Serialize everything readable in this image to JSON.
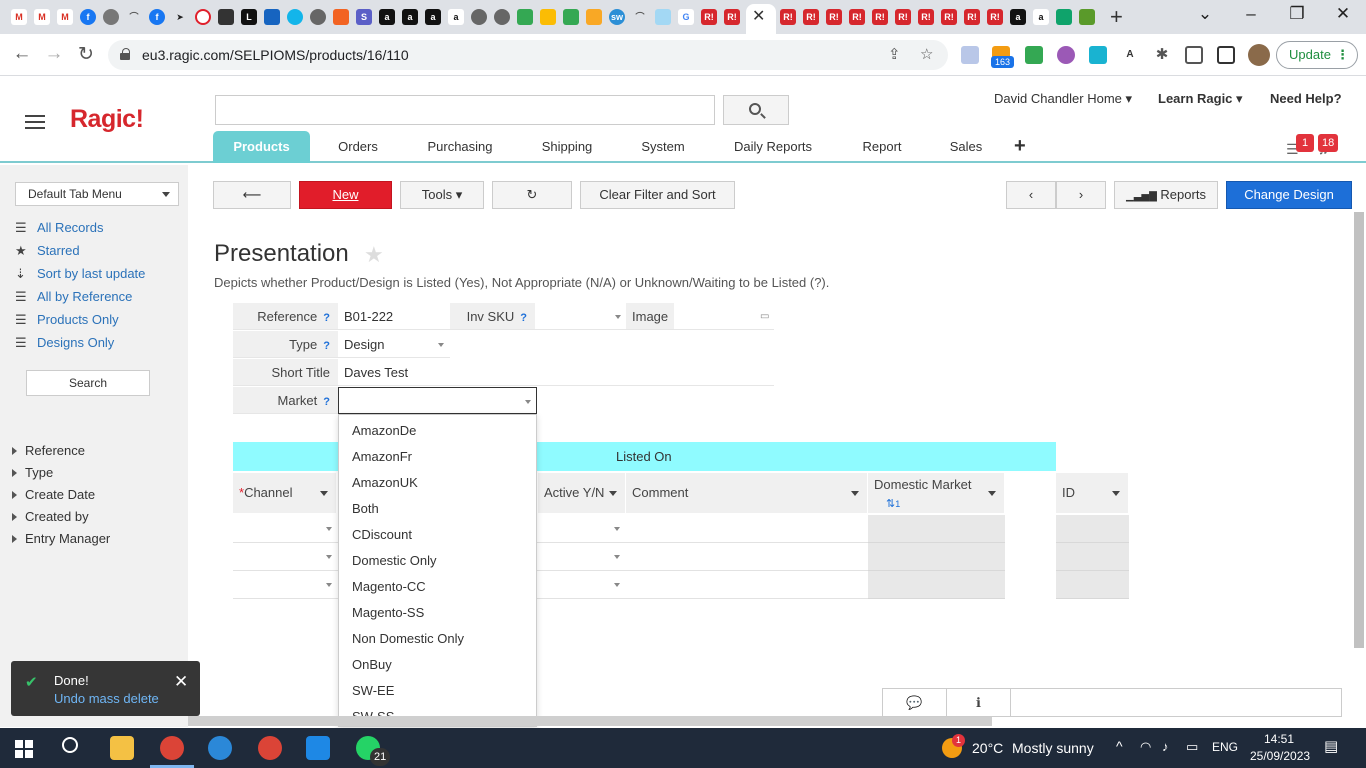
{
  "browser": {
    "url": "eu3.ragic.com/SELPIOMS/products/16/110",
    "update_label": "Update",
    "ext_badge": "163"
  },
  "header": {
    "logo": "Ragic!",
    "home_link": "David Chandler Home",
    "learn_link": "Learn Ragic",
    "help_link": "Need Help?",
    "tabs": [
      "Products",
      "Orders",
      "Purchasing",
      "Shipping",
      "System",
      "Daily Reports",
      "Report",
      "Sales"
    ],
    "plus": "+",
    "badge_tasks": "1",
    "badge_notifications": "18"
  },
  "sidebar": {
    "tab_menu": "Default Tab Menu",
    "views": [
      "All Records",
      "Starred",
      "Sort by last update",
      "All by Reference",
      "Products Only",
      "Designs Only"
    ],
    "search_label": "Search",
    "fields": [
      "Reference",
      "Type",
      "Create Date",
      "Created by",
      "Entry Manager"
    ]
  },
  "actions": {
    "new_label": "New",
    "tools_label": "Tools",
    "clear_label": "Clear Filter and Sort",
    "reports_label": "Reports",
    "change_design_label": "Change Design"
  },
  "form": {
    "title": "Presentation",
    "description": "Depicts whether Product/Design is Listed (Yes), Not Appropriate (N/A) or Unknown/Waiting to be Listed (?).",
    "reference_label": "Reference",
    "reference_value": "B01-222",
    "invsku_label": "Inv SKU",
    "image_label": "Image",
    "type_label": "Type",
    "type_value": "Design",
    "short_title_label": "Short Title",
    "short_title_value": "Daves Test",
    "market_label": "Market",
    "help_mark": "?"
  },
  "subtable": {
    "title": "Listed On",
    "req_mark": "*",
    "col_channel": "Channel",
    "col_active": "Active Y/N",
    "col_comment": "Comment",
    "col_domestic": "Domestic Market",
    "col_domestic_sort": "1",
    "col_id": "ID"
  },
  "dropdown": {
    "options": [
      "AmazonDe",
      "AmazonFr",
      "AmazonUK",
      "Both",
      "CDiscount",
      "Domestic Only",
      "Magento-CC",
      "Magento-SS",
      "Non Domestic Only",
      "OnBuy",
      "SW-EE",
      "SW-SS"
    ]
  },
  "toast": {
    "title": "Done!",
    "link": "Undo mass delete"
  },
  "taskbar": {
    "whatsapp_badge": "21",
    "weather_temp": "20°C",
    "weather_text": "Mostly sunny",
    "weather_badge": "1",
    "language": "ENG",
    "time": "14:51",
    "date": "25/09/2023"
  },
  "colors": {
    "accent": "#6ccfd3",
    "new_button": "#e11d2a",
    "design_button": "#1d6fd8",
    "subtable_header": "#8ffbff"
  }
}
